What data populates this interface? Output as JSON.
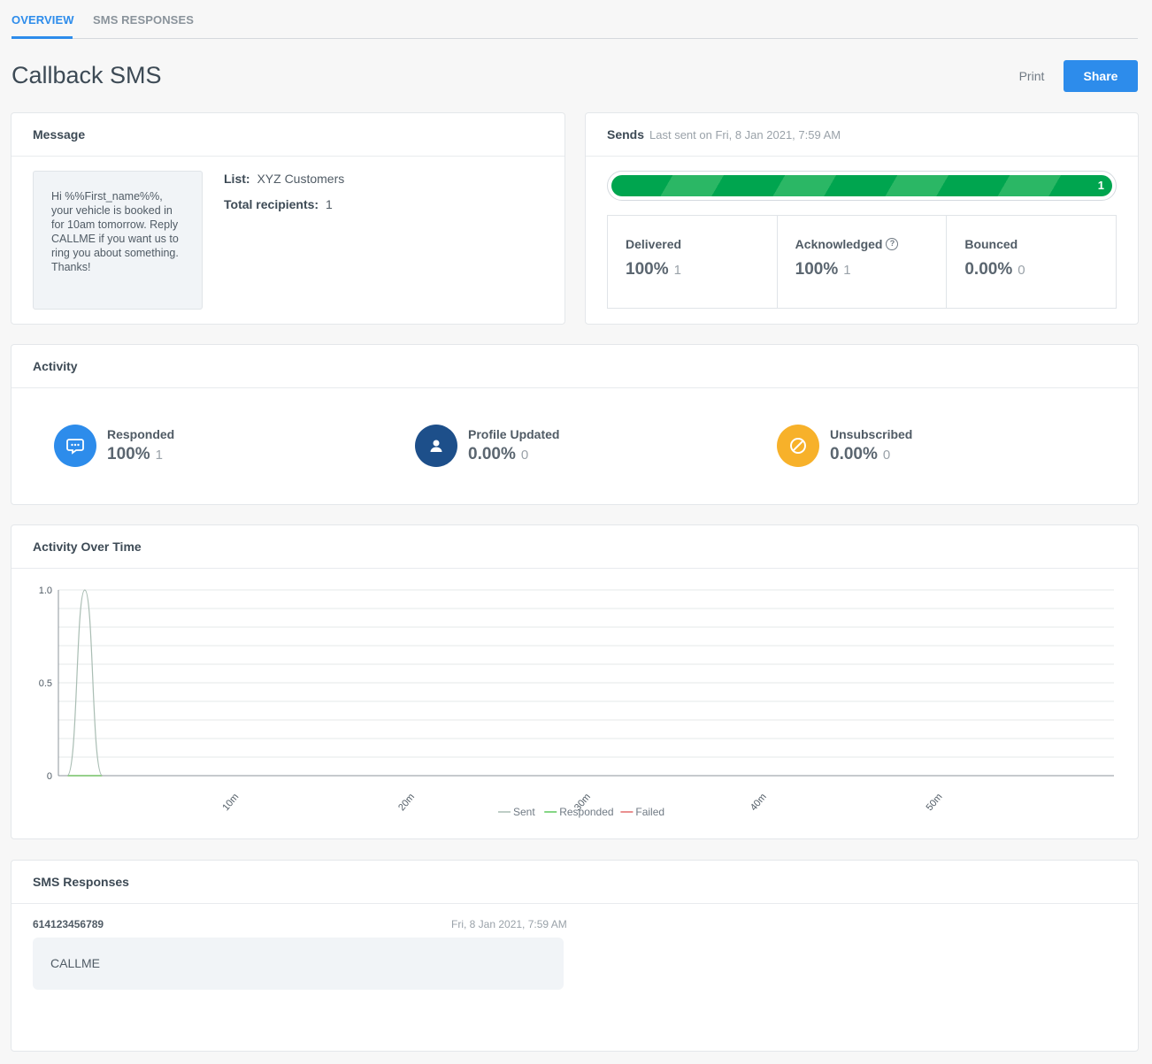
{
  "tabs": [
    {
      "label": "OVERVIEW",
      "active": true
    },
    {
      "label": "SMS RESPONSES",
      "active": false
    }
  ],
  "page": {
    "title": "Callback SMS",
    "print_label": "Print",
    "share_label": "Share",
    "accent_color": "#2d8ceb"
  },
  "message": {
    "header": "Message",
    "body": "Hi %%First_name%%, your vehicle is booked in for 10am tomorrow. Reply CALLME if you want us to ring you about something. Thanks!",
    "list_label": "List:",
    "list_value": "XYZ Customers",
    "recipients_label": "Total recipients:",
    "recipients_value": "1"
  },
  "sends": {
    "header": "Sends",
    "last_sent": "Last sent on Fri, 8 Jan 2021, 7:59 AM",
    "progress_count": "1",
    "progress_fraction": 1.0,
    "stats": [
      {
        "label": "Delivered",
        "value": "100%",
        "count": "1",
        "help": false
      },
      {
        "label": "Acknowledged",
        "value": "100%",
        "count": "1",
        "help": true
      },
      {
        "label": "Bounced",
        "value": "0.00%",
        "count": "0",
        "help": false
      }
    ]
  },
  "activity": {
    "header": "Activity",
    "items": [
      {
        "label": "Responded",
        "value": "100%",
        "count": "1",
        "icon": "chat-bubble-icon",
        "color": "#2d8ceb"
      },
      {
        "label": "Profile Updated",
        "value": "0.00%",
        "count": "0",
        "icon": "person-icon",
        "color": "#1d4f8a"
      },
      {
        "label": "Unsubscribed",
        "value": "0.00%",
        "count": "0",
        "icon": "block-icon",
        "color": "#f7b12a"
      }
    ]
  },
  "activity_over_time": {
    "header": "Activity Over Time"
  },
  "chart_data": {
    "type": "line",
    "x_unit": "minutes",
    "xlim": [
      0,
      60
    ],
    "ylim": [
      0,
      1
    ],
    "y_ticks": [
      "1.0",
      "0.5",
      "0"
    ],
    "y_tick_values": [
      1.0,
      0.5,
      0
    ],
    "x_ticks": [
      "10m",
      "20m",
      "30m",
      "40m",
      "50m"
    ],
    "x_tick_values": [
      10,
      20,
      30,
      40,
      50
    ],
    "grid": true,
    "legend_placement": "bottom-center",
    "series": [
      {
        "name": "Sent",
        "color": "#a9bdb3",
        "x": [
          0.5,
          1.5,
          2.5
        ],
        "y": [
          0,
          1,
          0
        ]
      },
      {
        "name": "Responded",
        "color": "#5cc95c",
        "x": [
          0.5,
          2.5
        ],
        "y": [
          0,
          0
        ]
      },
      {
        "name": "Failed",
        "color": "#e26b6b",
        "x": [
          0.5,
          2.5
        ],
        "y": [
          0,
          0
        ]
      }
    ]
  },
  "sms_responses": {
    "header": "SMS Responses",
    "items": [
      {
        "number": "614123456789",
        "time": "Fri, 8 Jan 2021, 7:59 AM",
        "text": "CALLME"
      }
    ]
  }
}
